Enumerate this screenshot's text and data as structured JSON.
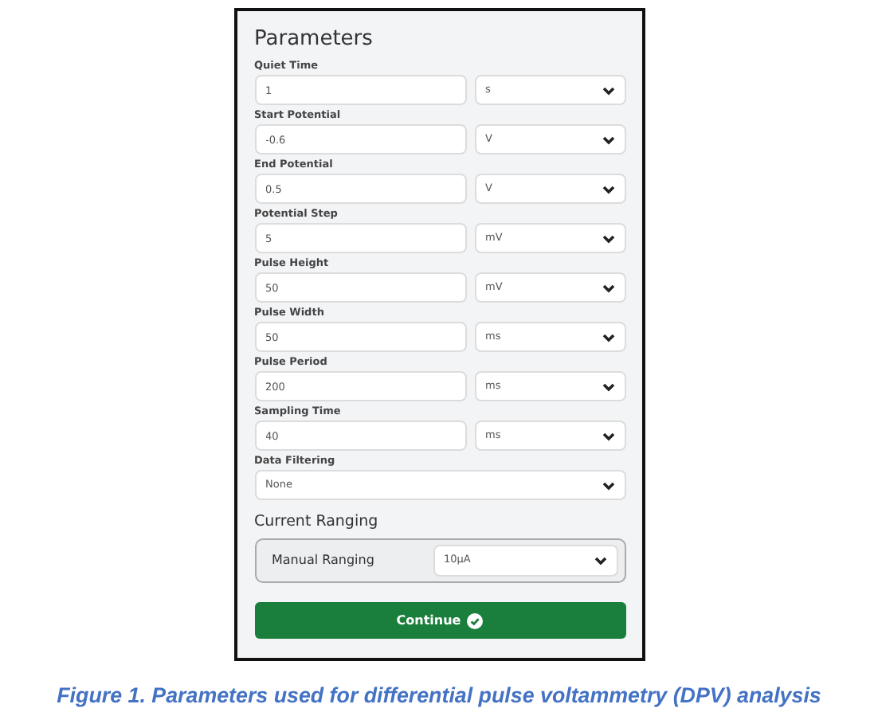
{
  "panel": {
    "title": "Parameters",
    "parameters": [
      {
        "label": "Quiet Time",
        "value": "1",
        "unit": "s"
      },
      {
        "label": "Start Potential",
        "value": "-0.6",
        "unit": "V"
      },
      {
        "label": "End Potential",
        "value": "0.5",
        "unit": "V"
      },
      {
        "label": "Potential Step",
        "value": "5",
        "unit": "mV"
      },
      {
        "label": "Pulse Height",
        "value": "50",
        "unit": "mV"
      },
      {
        "label": "Pulse Width",
        "value": "50",
        "unit": "ms"
      },
      {
        "label": "Pulse Period",
        "value": "200",
        "unit": "ms"
      },
      {
        "label": "Sampling Time",
        "value": "40",
        "unit": "ms"
      }
    ],
    "data_filtering": {
      "label": "Data Filtering",
      "value": "None"
    },
    "current_ranging": {
      "heading": "Current Ranging",
      "label": "Manual Ranging",
      "value": "10µA"
    },
    "button": "Continue"
  },
  "caption": "Figure 1. Parameters used for differential pulse voltammetry (DPV) analysis"
}
